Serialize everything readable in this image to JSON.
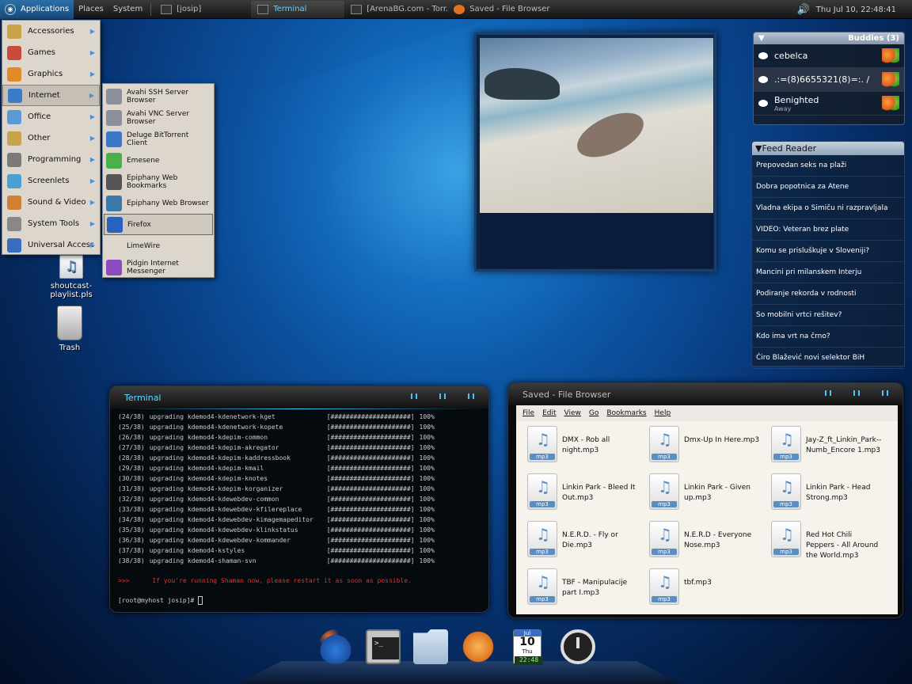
{
  "top_panel": {
    "menus": [
      "Applications",
      "Places",
      "System"
    ],
    "tasks": [
      {
        "label": "[josip]"
      },
      {
        "label": "Terminal"
      },
      {
        "label": "[ArenaBG.com - Torr..."
      },
      {
        "label": "Saved - File Browser"
      }
    ],
    "clock": "Thu Jul 10, 22:48:41"
  },
  "app_menu": {
    "items": [
      {
        "label": "Accessories",
        "icon": "accessories-icon",
        "color": "#c9a34a"
      },
      {
        "label": "Games",
        "icon": "games-icon",
        "color": "#c84b3c"
      },
      {
        "label": "Graphics",
        "icon": "graphics-icon",
        "color": "#e08a2a"
      },
      {
        "label": "Internet",
        "icon": "internet-icon",
        "color": "#3a7cc9"
      },
      {
        "label": "Office",
        "icon": "office-icon",
        "color": "#5a9bd4"
      },
      {
        "label": "Other",
        "icon": "other-icon",
        "color": "#c9a34a"
      },
      {
        "label": "Programming",
        "icon": "programming-icon",
        "color": "#7a7a7a"
      },
      {
        "label": "Screenlets",
        "icon": "screenlets-icon",
        "color": "#4aa0d0"
      },
      {
        "label": "Sound & Video",
        "icon": "sound-video-icon",
        "color": "#d08030"
      },
      {
        "label": "System Tools",
        "icon": "system-tools-icon",
        "color": "#888888"
      },
      {
        "label": "Universal Access",
        "icon": "universal-access-icon",
        "color": "#3a6ec0"
      }
    ],
    "highlighted": "Internet"
  },
  "internet_submenu": {
    "items": [
      {
        "label": "Avahi SSH Server Browser",
        "icon": "avahi-ssh-icon",
        "color": "#8a8f99"
      },
      {
        "label": "Avahi VNC Server Browser",
        "icon": "avahi-vnc-icon",
        "color": "#8a8f99"
      },
      {
        "label": "Deluge BitTorrent Client",
        "icon": "deluge-icon",
        "color": "#3a78c8"
      },
      {
        "label": "Emesene",
        "icon": "emesene-icon",
        "color": "#4ab04a"
      },
      {
        "label": "Epiphany Web Bookmarks",
        "icon": "epiphany-bookmarks-icon",
        "color": "#555555"
      },
      {
        "label": "Epiphany Web Browser",
        "icon": "epiphany-browser-icon",
        "color": "#3a78a8"
      },
      {
        "label": "Firefox",
        "icon": "firefox-icon",
        "color": "#2a60c0"
      },
      {
        "label": "LimeWire",
        "icon": "limewire-icon",
        "color": ""
      },
      {
        "label": "Pidgin Internet Messenger",
        "icon": "pidgin-icon",
        "color": "#8a4ac0"
      }
    ],
    "highlighted": "Firefox"
  },
  "desktop": {
    "icons": [
      {
        "label": "shoutcast-playlist.pls",
        "icon": "playlist-file-icon"
      },
      {
        "label": "Trash",
        "icon": "trash-icon"
      }
    ]
  },
  "buddies": {
    "title": "Buddies (3)",
    "list": [
      {
        "name": "cebelca",
        "status": ""
      },
      {
        "name": ".:=(8)6655321(8)=:. /",
        "status": ""
      },
      {
        "name": "Benighted",
        "status": "Away"
      }
    ]
  },
  "feed_reader": {
    "title": "Feed Reader",
    "items": [
      "Prepovedan seks na plaži",
      "Dobra popotnica za Atene",
      "Vladna ekipa o Simiču ni razpravljala",
      "VIDEO: Veteran brez plate",
      "Komu se prisluškuje v Sloveniji?",
      "Mancini pri milanskem Interju",
      "Podiranje rekorda v rodnosti",
      "So mobilni vrtci rešitev?",
      "Kdo ima vrt na črno?",
      "Ćiro Blažević novi selektor BiH"
    ]
  },
  "terminal": {
    "title": "Terminal",
    "lines": [
      {
        "n": "(24/38)",
        "pkg": "upgrading kdemod4-kdenetwork-kget",
        "bar": "[#####################]",
        "pct": "100%"
      },
      {
        "n": "(25/38)",
        "pkg": "upgrading kdemod4-kdenetwork-kopete",
        "bar": "[#####################]",
        "pct": "100%"
      },
      {
        "n": "(26/38)",
        "pkg": "upgrading kdemod4-kdepim-common",
        "bar": "[#####################]",
        "pct": "100%"
      },
      {
        "n": "(27/38)",
        "pkg": "upgrading kdemod4-kdepim-akregator",
        "bar": "[#####################]",
        "pct": "100%"
      },
      {
        "n": "(28/38)",
        "pkg": "upgrading kdemod4-kdepim-kaddressbook",
        "bar": "[#####################]",
        "pct": "100%"
      },
      {
        "n": "(29/38)",
        "pkg": "upgrading kdemod4-kdepim-kmail",
        "bar": "[#####################]",
        "pct": "100%"
      },
      {
        "n": "(30/38)",
        "pkg": "upgrading kdemod4-kdepim-knotes",
        "bar": "[#####################]",
        "pct": "100%"
      },
      {
        "n": "(31/38)",
        "pkg": "upgrading kdemod4-kdepim-korganizer",
        "bar": "[#####################]",
        "pct": "100%"
      },
      {
        "n": "(32/38)",
        "pkg": "upgrading kdemod4-kdewebdev-common",
        "bar": "[#####################]",
        "pct": "100%"
      },
      {
        "n": "(33/38)",
        "pkg": "upgrading kdemod4-kdewebdev-kfilereplace",
        "bar": "[#####################]",
        "pct": "100%"
      },
      {
        "n": "(34/38)",
        "pkg": "upgrading kdemod4-kdewebdev-kimagemapeditor",
        "bar": "[#####################]",
        "pct": "100%"
      },
      {
        "n": "(35/38)",
        "pkg": "upgrading kdemod4-kdewebdev-klinkstatus",
        "bar": "[#####################]",
        "pct": "100%"
      },
      {
        "n": "(36/38)",
        "pkg": "upgrading kdemod4-kdewebdev-kommander",
        "bar": "[#####################]",
        "pct": "100%"
      },
      {
        "n": "(37/38)",
        "pkg": "upgrading kdemod4-kstyles",
        "bar": "[#####################]",
        "pct": "100%"
      },
      {
        "n": "(38/38)",
        "pkg": "upgrading kdemod4-shaman-svn",
        "bar": "[#####################]",
        "pct": "100%"
      }
    ],
    "warning": ">>>      If you're running Shaman now, please restart it as soon as possible.",
    "prompt": "[root@myhost josip]# "
  },
  "file_browser": {
    "title": "Saved - File Browser",
    "menus": [
      "File",
      "Edit",
      "View",
      "Go",
      "Bookmarks",
      "Help"
    ],
    "files": [
      "DMX - Rob all night.mp3",
      "Dmx-Up In Here.mp3",
      "Jay-Z_ft_Linkin_Park--Numb_Encore 1.mp3",
      "Linkin Park - Bleed It Out.mp3",
      "Linkin Park - Given up.mp3",
      "Linkin Park - Head Strong.mp3",
      "N.E.R.D. - Fly or Die.mp3",
      "N.E.R.D - Everyone Nose.mp3",
      "Red Hot Chili Peppers - All Around the World.mp3",
      "TBF - Manipulacije part I.mp3",
      "tbf.mp3"
    ],
    "file_icon_label": "mp3"
  },
  "dock": {
    "items": [
      {
        "name": "firefox-dock-icon"
      },
      {
        "name": "terminal-dock-icon"
      },
      {
        "name": "folder-dock-icon"
      },
      {
        "name": "nautilus-shell-dock-icon"
      },
      {
        "name": "calendar-dock-icon"
      },
      {
        "name": "power-dock-icon"
      }
    ],
    "calendar": {
      "month": "Jul",
      "day": "10",
      "weekday": "Thu",
      "time": "22:48"
    }
  }
}
